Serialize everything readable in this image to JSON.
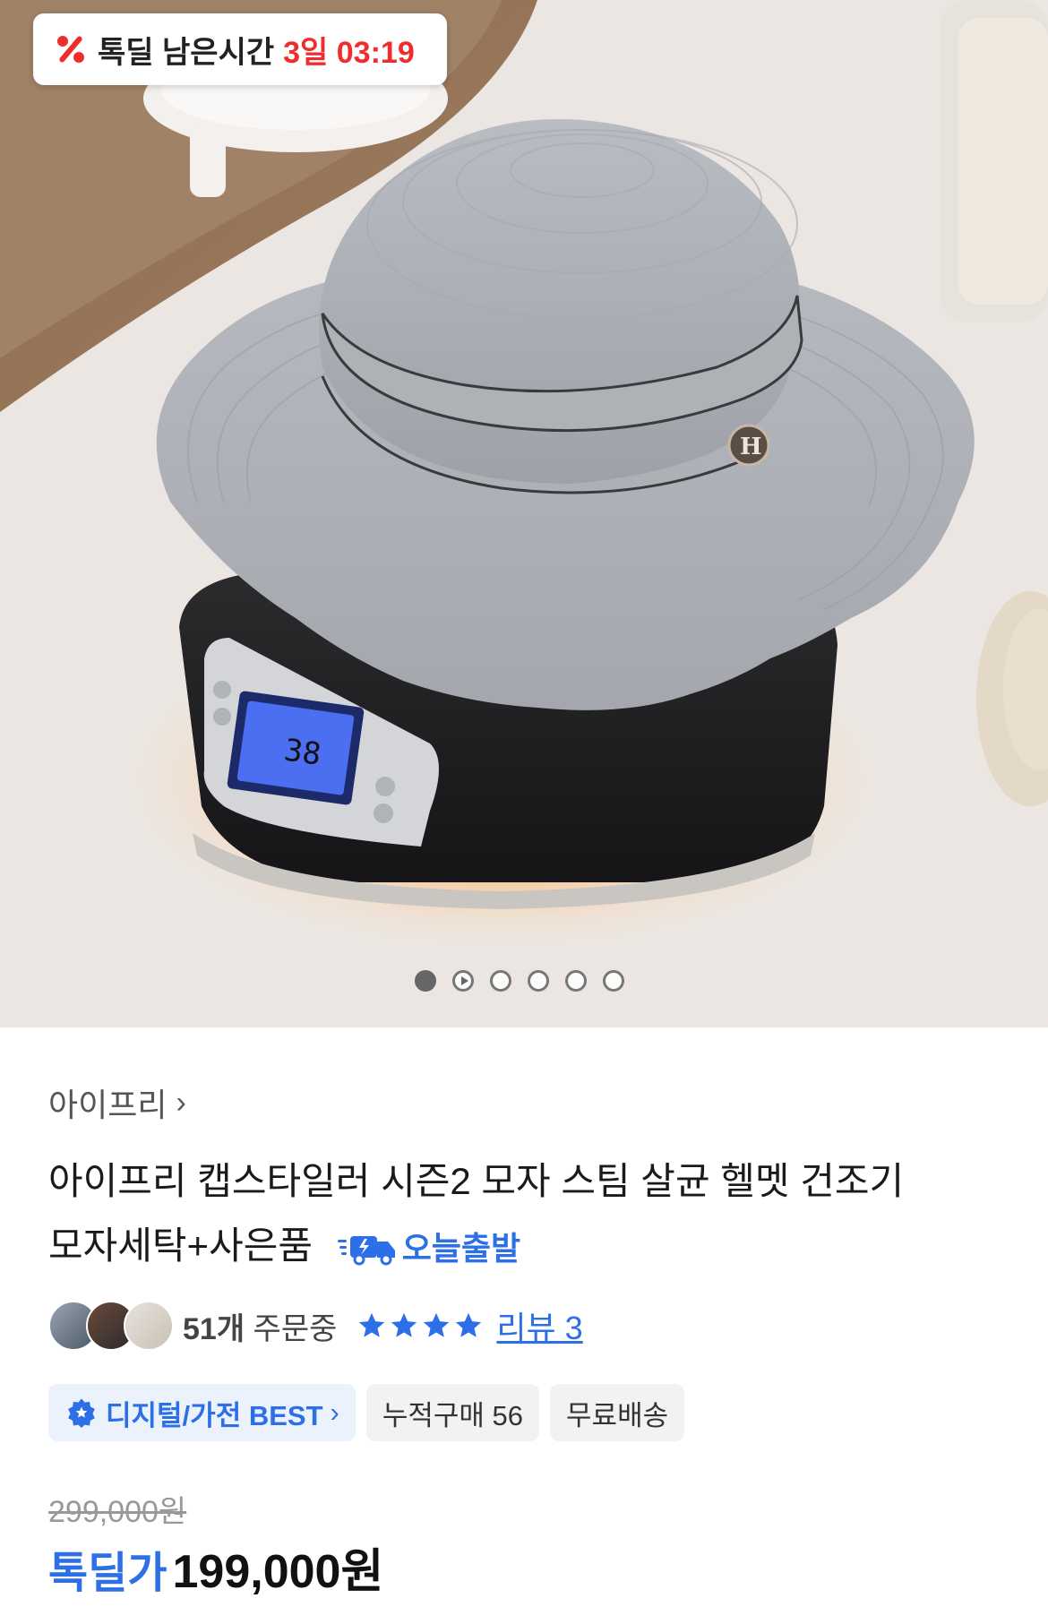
{
  "deal": {
    "icon": "percent-icon",
    "label": "톡딜 남은시간",
    "time": "3일 03:19"
  },
  "gallery": {
    "scale_display": "38",
    "slide_count": 6,
    "current_index": 0
  },
  "seller": {
    "name": "아이프리",
    "chevron": "›"
  },
  "product": {
    "title_line1": "아이프리 캡스타일러 시즌2 모자 스팀 살균 헬멧 건조기",
    "title_line2": "모자세탁+사은품",
    "delivery_badge": "오늘출발"
  },
  "stats": {
    "orders_count": "51개",
    "orders_suffix": " 주문중",
    "rating_stars": 4,
    "review_link": "리뷰 3"
  },
  "tags": {
    "best_label": "디지털/가전 BEST",
    "best_chevron": "›",
    "cumulative": "누적구매 56",
    "shipping": "무료배송"
  },
  "price": {
    "original": "299,000원",
    "deal_label": "톡딜가",
    "deal_price": "199,000원"
  },
  "colors": {
    "accent_blue": "#2d6fe6",
    "deal_red": "#f02d2d",
    "scale_lcd": "#4b6ff0"
  }
}
